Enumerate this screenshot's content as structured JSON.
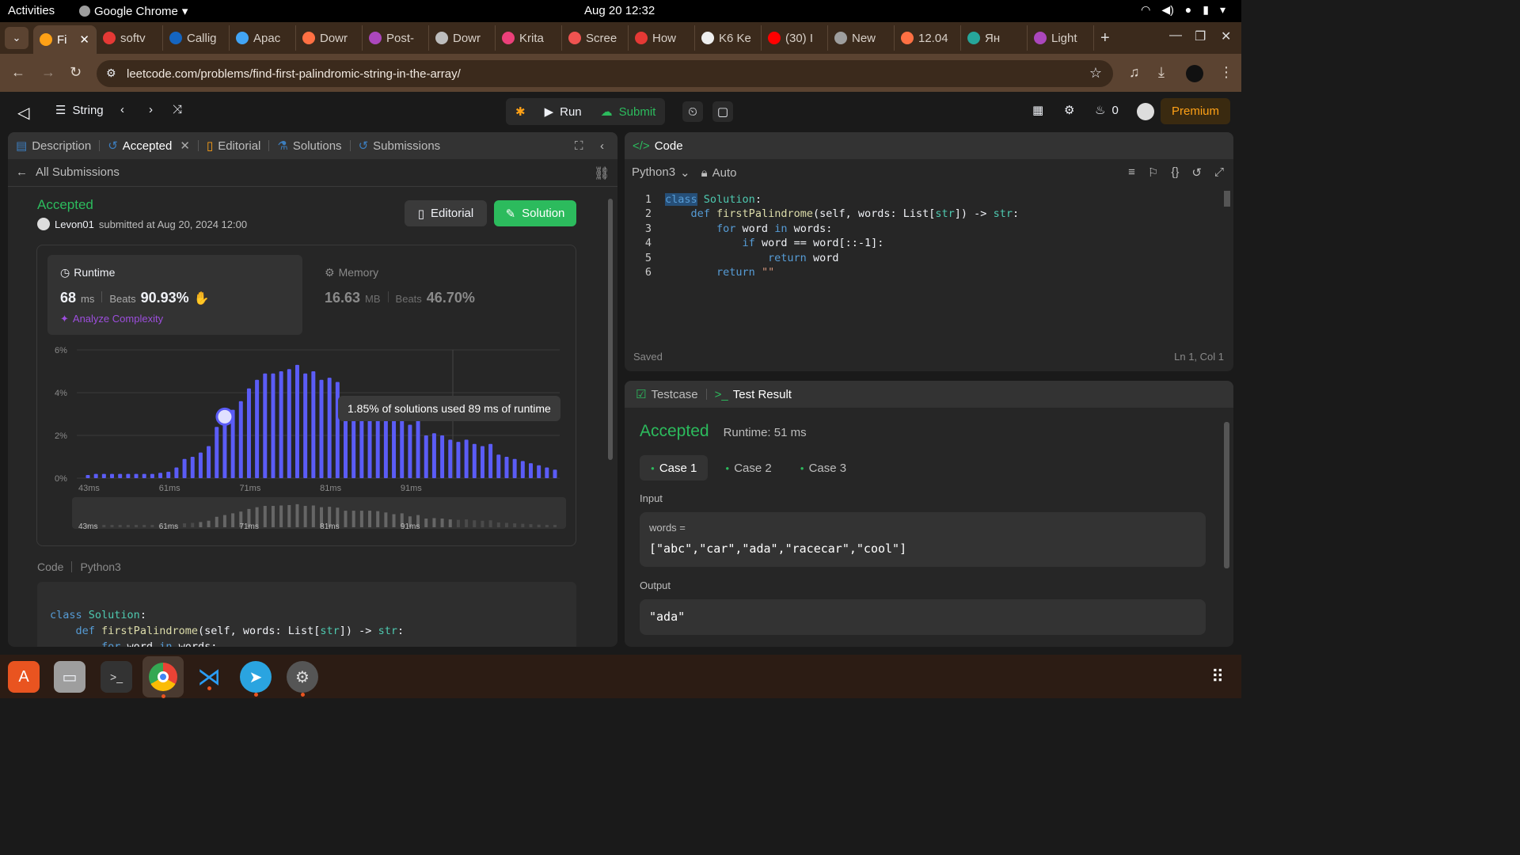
{
  "os": {
    "activities": "Activities",
    "app_name": "Google Chrome",
    "clock": "Aug 20  12:32"
  },
  "browser": {
    "tabs": [
      {
        "label": "Fi",
        "color": "#ffa116",
        "active": true
      },
      {
        "label": "softv",
        "color": "#e53935"
      },
      {
        "label": "Callig",
        "color": "#1565c0"
      },
      {
        "label": "Apac",
        "color": "#42a5f5"
      },
      {
        "label": "Dowr",
        "color": "#ff7043"
      },
      {
        "label": "Post-",
        "color": "#ab47bc"
      },
      {
        "label": "Dowr",
        "color": "#bdbdbd"
      },
      {
        "label": "Krita",
        "color": "#ec407a"
      },
      {
        "label": "Scree",
        "color": "#ef5350"
      },
      {
        "label": "How",
        "color": "#e53935"
      },
      {
        "label": "K6 Ke",
        "color": "#eeeeee"
      },
      {
        "label": "(30) I",
        "color": "#ff0000"
      },
      {
        "label": "New",
        "color": "#9e9e9e"
      },
      {
        "label": "12.04",
        "color": "#ff7043"
      },
      {
        "label": "Ян",
        "color": "#26a69a"
      },
      {
        "label": "Light",
        "color": "#ab47bc"
      }
    ],
    "new_tab": "+",
    "url": "leetcode.com/problems/find-first-palindromic-string-in-the-array/"
  },
  "header": {
    "problem_list": "String",
    "run": "Run",
    "submit": "Submit",
    "streak": "0",
    "premium": "Premium"
  },
  "left_panel": {
    "tabs": [
      "Description",
      "Accepted",
      "Editorial",
      "Solutions",
      "Submissions"
    ],
    "back_link": "All Submissions",
    "status": "Accepted",
    "user": "Levon01",
    "submitted": "submitted at Aug 20, 2024 12:00",
    "editorial_btn": "Editorial",
    "solution_btn": "Solution",
    "runtime": {
      "title": "Runtime",
      "value": "68",
      "unit": "ms",
      "beats_label": "Beats",
      "beats": "90.93%",
      "analyze": "Analyze Complexity"
    },
    "memory": {
      "title": "Memory",
      "value": "16.63",
      "unit": "MB",
      "beats_label": "Beats",
      "beats": "46.70%"
    },
    "tooltip": "1.85% of solutions used 89 ms of runtime",
    "code_label": "Code",
    "code_lang": "Python3"
  },
  "chart_data": {
    "type": "bar",
    "title": "",
    "xlabel": "",
    "ylabel": "",
    "y_ticks": [
      "0%",
      "2%",
      "4%",
      "6%"
    ],
    "x_ticks": [
      "43ms",
      "61ms",
      "71ms",
      "81ms",
      "91ms"
    ],
    "ylim": [
      0,
      6
    ],
    "highlight_index": 17,
    "values": [
      0.15,
      0.2,
      0.2,
      0.2,
      0.2,
      0.2,
      0.2,
      0.2,
      0.2,
      0.25,
      0.3,
      0.5,
      0.9,
      1.0,
      1.2,
      1.5,
      2.4,
      2.8,
      3.2,
      3.6,
      4.2,
      4.6,
      4.9,
      4.9,
      5.0,
      5.1,
      5.3,
      4.9,
      5.0,
      4.6,
      4.7,
      4.5,
      3.8,
      3.8,
      3.8,
      3.8,
      3.7,
      3.4,
      3.0,
      3.2,
      2.5,
      2.8,
      2.0,
      2.1,
      2.0,
      1.8,
      1.7,
      1.8,
      1.6,
      1.5,
      1.6,
      1.1,
      1.0,
      0.9,
      0.8,
      0.7,
      0.6,
      0.5,
      0.4
    ]
  },
  "editor": {
    "title": "Code",
    "lang": "Python3",
    "mode": "Auto",
    "status": "Saved",
    "cursor": "Ln 1, Col 1"
  },
  "result": {
    "tab_testcase": "Testcase",
    "tab_result": "Test Result",
    "status": "Accepted",
    "runtime": "Runtime: 51 ms",
    "cases": [
      "Case 1",
      "Case 2",
      "Case 3"
    ],
    "input_label": "Input",
    "input_var": "words =",
    "input_value": "[\"abc\",\"car\",\"ada\",\"racecar\",\"cool\"]",
    "output_label": "Output",
    "output_value": "\"ada\""
  }
}
